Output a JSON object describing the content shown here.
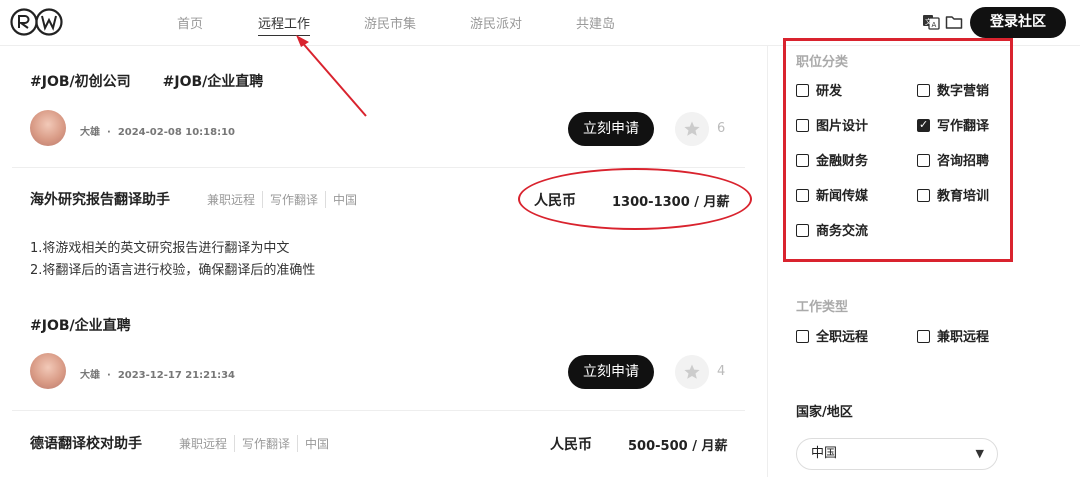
{
  "header": {
    "nav": [
      "首页",
      "远程工作",
      "游民市集",
      "游民派对",
      "共建岛"
    ],
    "login_label": "登录社区"
  },
  "feed": {
    "post1": {
      "tags": [
        "#JOB/初创公司",
        "#JOB/企业直聘"
      ],
      "author": "大雄",
      "time": "2024-02-08 10:18:10",
      "apply_label": "立刻申请",
      "star_count": "6"
    },
    "job1": {
      "title": "海外研究报告翻译助手",
      "tags": [
        "兼职远程",
        "写作翻译",
        "中国"
      ],
      "currency": "人民币",
      "salary": "1300-1300 / 月薪",
      "desc": [
        "1.将游戏相关的英文研究报告进行翻译为中文",
        "2.将翻译后的语言进行校验，确保翻译后的准确性"
      ]
    },
    "post2": {
      "tags": [
        "#JOB/企业直聘"
      ],
      "author": "大雄",
      "time": "2023-12-17 21:21:34",
      "apply_label": "立刻申请",
      "star_count": "4"
    },
    "job2": {
      "title": "德语翻译校对助手",
      "tags": [
        "兼职远程",
        "写作翻译",
        "中国"
      ],
      "currency": "人民币",
      "salary": "500-500 / 月薪"
    }
  },
  "sidebar": {
    "category_title": "职位分类",
    "categories": [
      {
        "label": "研发",
        "checked": false
      },
      {
        "label": "数字营销",
        "checked": false
      },
      {
        "label": "图片设计",
        "checked": false
      },
      {
        "label": "写作翻译",
        "checked": true
      },
      {
        "label": "金融财务",
        "checked": false
      },
      {
        "label": "咨询招聘",
        "checked": false
      },
      {
        "label": "新闻传媒",
        "checked": false
      },
      {
        "label": "教育培训",
        "checked": false
      },
      {
        "label": "商务交流",
        "checked": false
      }
    ],
    "jobtype_title": "工作类型",
    "jobtypes": [
      {
        "label": "全职远程",
        "checked": false
      },
      {
        "label": "兼职远程",
        "checked": false
      }
    ],
    "country_title": "国家/地区",
    "country_value": "中国"
  },
  "colors": {
    "annotation": "#d9232e",
    "button": "#111111"
  }
}
